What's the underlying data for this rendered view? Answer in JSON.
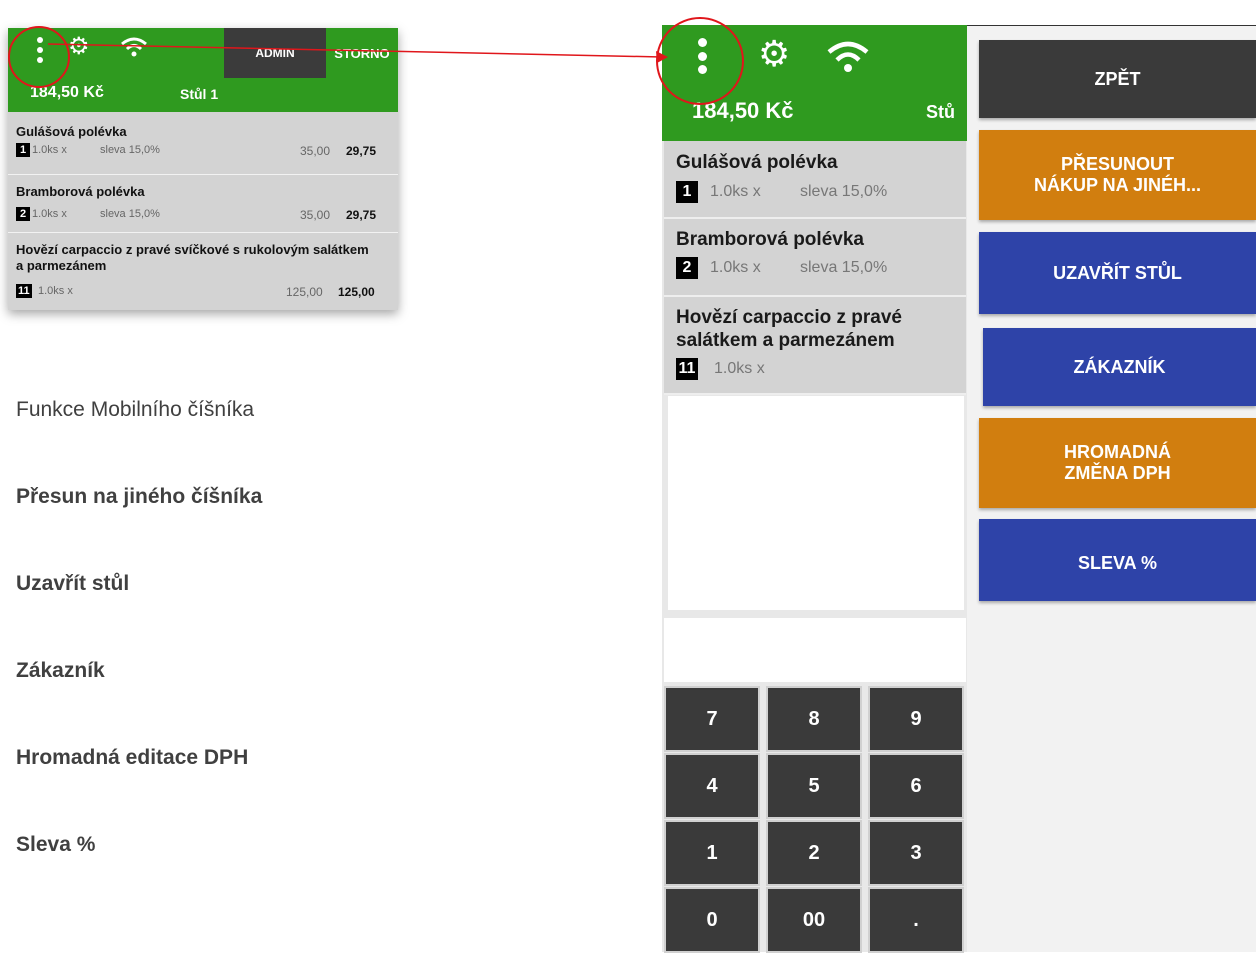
{
  "colors": {
    "header_green": "#2f9a1f",
    "button_dark": "#3a3a3a",
    "button_orange": "#d17e0f",
    "button_blue": "#2e43a8",
    "annotation_red": "#e0161b"
  },
  "preview": {
    "admin_label": "ADMIN",
    "storno_label": "STORNO",
    "total": "184,50 Kč",
    "table": "Stůl 1",
    "items": [
      {
        "name": "Gulášová polévka",
        "index": "1",
        "qty": "1.0ks x",
        "discount": "sleva 15,0%",
        "price": "35,00",
        "final": "29,75"
      },
      {
        "name": "Bramborová polévka",
        "index": "2",
        "qty": "1.0ks x",
        "discount": "sleva 15,0%",
        "price": "35,00",
        "final": "29,75"
      },
      {
        "name": "Hovězí carpaccio z pravé svíčkové s rukolovým salátkem a parmezánem",
        "index": "11",
        "qty": "1.0ks x",
        "discount": "",
        "price": "125,00",
        "final": "125,00"
      }
    ]
  },
  "features": {
    "title": "Funkce Mobilního číšníka",
    "items": [
      "Přesun na jiného číšníka",
      "Uzavřít stůl",
      "Zákazník",
      "Hromadná editace DPH",
      "Sleva %"
    ]
  },
  "big": {
    "total": "184,50 Kč",
    "table": "Stů",
    "items": [
      {
        "name": "Gulášová polévka",
        "index": "1",
        "qty": "1.0ks x",
        "discount": "sleva 15,0%"
      },
      {
        "name": "Bramborová polévka",
        "index": "2",
        "qty": "1.0ks x",
        "discount": "sleva 15,0%"
      },
      {
        "name_line1": "Hovězí carpaccio z pravé",
        "name_line2": "salátkem a parmezánem",
        "index": "11",
        "qty": "1.0ks x"
      }
    ],
    "keypad": [
      "7",
      "8",
      "9",
      "4",
      "5",
      "6",
      "1",
      "2",
      "3",
      "0",
      "00",
      "."
    ],
    "actions": {
      "back": "ZPĚT",
      "move_line1": "PŘESUNOUT",
      "move_line2": "NÁKUP NA JINÉH...",
      "close_table": "UZAVŘÍT STŮL",
      "customer": "ZÁKAZNÍK",
      "vat_line1": "HROMADNÁ",
      "vat_line2": "ZMĚNA DPH",
      "discount": "SLEVA %"
    }
  },
  "icons": [
    "more-vertical-icon",
    "gear-icon",
    "wifi-icon"
  ]
}
